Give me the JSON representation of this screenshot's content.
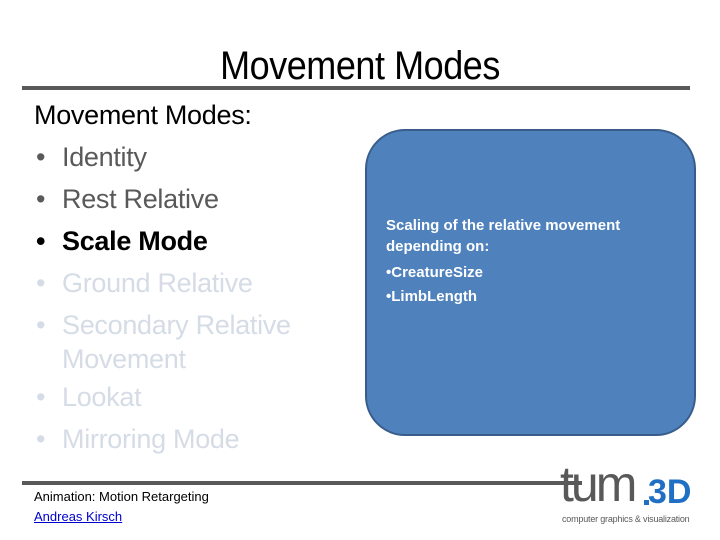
{
  "slide": {
    "title": "Movement Modes",
    "list_heading": "Movement Modes:",
    "bullet_glyph": "•",
    "items": [
      {
        "label": "Identity",
        "state": "past"
      },
      {
        "label": "Rest Relative",
        "state": "past"
      },
      {
        "label": "Scale Mode",
        "state": "current"
      },
      {
        "label": "Ground Relative",
        "state": "upcoming"
      },
      {
        "label": "Secondary Relative",
        "continuation": "Movement",
        "state": "upcoming"
      },
      {
        "label": "Lookat",
        "state": "upcoming"
      },
      {
        "label": "Mirroring Mode",
        "state": "upcoming"
      }
    ],
    "callout": {
      "line1": "Scaling of the relative movement",
      "line2": "depending on:",
      "bullets": [
        "•CreatureSize",
        "•LimbLength"
      ],
      "fill_color": "#4f81bd",
      "border_color": "#385d8a"
    }
  },
  "footer": {
    "course": "Animation: Motion Retargeting",
    "author": "Andreas Kirsch",
    "logo": {
      "main": "tum",
      "accent": "3D",
      "subtitle": "computer graphics & visualization",
      "accent_color": "#1f6fc5"
    }
  }
}
